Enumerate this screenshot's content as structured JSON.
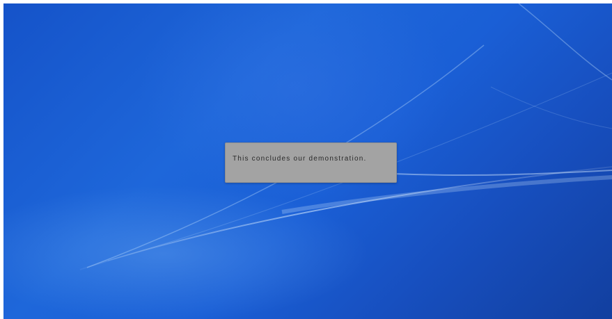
{
  "desktop": {
    "wallpaper_colors": [
      "#1553c9",
      "#1e67da",
      "#123f9f"
    ]
  },
  "dialog": {
    "message": "This concludes our demonstration."
  }
}
